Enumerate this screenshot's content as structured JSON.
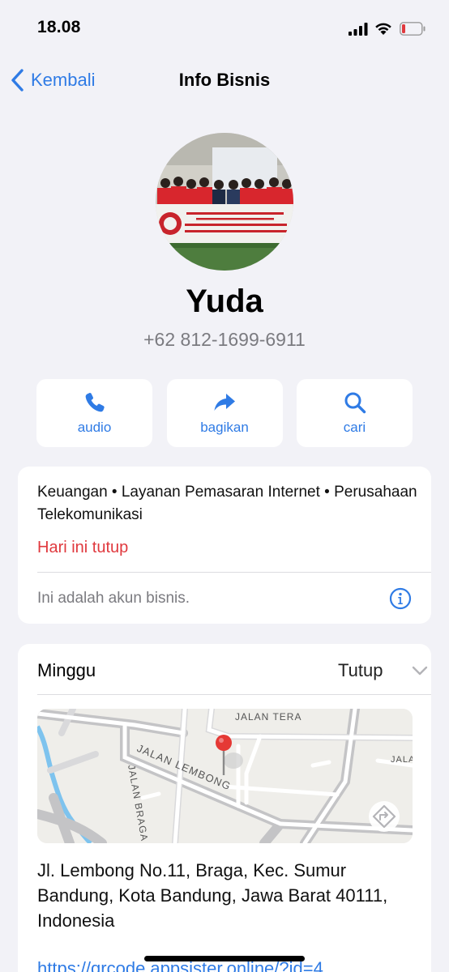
{
  "status_bar": {
    "time": "18.08"
  },
  "nav": {
    "back_label": "Kembali",
    "title": "Info Bisnis"
  },
  "profile": {
    "name": "Yuda",
    "phone": "+62 812-1699-6911",
    "avatar_banner_text": "TELKOM WITEL BANDUNG MENERIMA SERTIFIKASI ISO 37001:2016 SISTEM MANAJEMEN ANTI PENYUAPAN"
  },
  "actions": [
    {
      "label": "audio",
      "icon": "phone-icon"
    },
    {
      "label": "bagikan",
      "icon": "share-arrow-icon"
    },
    {
      "label": "cari",
      "icon": "search-icon"
    }
  ],
  "business_info": {
    "categories": "Keuangan • Layanan Pemasaran Internet • Perusahaan Telekomunikasi",
    "open_status": "Hari ini tutup",
    "business_note": "Ini adalah akun bisnis."
  },
  "hours": {
    "day": "Minggu",
    "status": "Tutup"
  },
  "map": {
    "street_labels": [
      "JALAN TERA",
      "JALAN LEMBONG",
      "JALAN BRAGA",
      "JALA"
    ]
  },
  "location": {
    "address": "Jl. Lembong No.11, Braga, Kec. Sumur Bandung, Kota Bandung, Jawa Barat 40111, Indonesia",
    "url": "https://qrcode.appsister.online/?id=4"
  },
  "colors": {
    "accent": "#2f7be5",
    "closed": "#e0393e",
    "background": "#f2f2f7",
    "map_pin": "#e53935"
  }
}
